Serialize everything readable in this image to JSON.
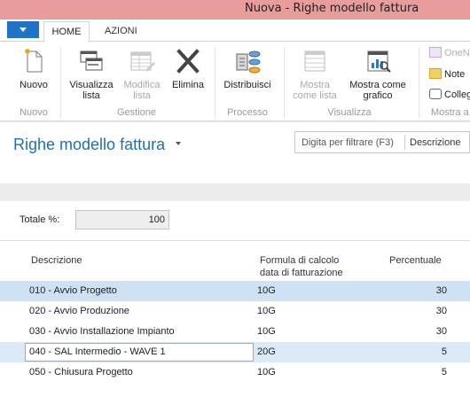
{
  "window": {
    "title": "Nuova - Righe modello fattura"
  },
  "tabs": {
    "home": "HOME",
    "azioni": "AZIONI"
  },
  "ribbon": {
    "nuovo": "Nuovo",
    "visualizza_lista": [
      "Visualizza",
      "lista"
    ],
    "modifica_lista": [
      "Modifica",
      "lista"
    ],
    "elimina": "Elimina",
    "distribuisci": "Distribuisci",
    "mostra_come_lista": [
      "Mostra",
      "come lista"
    ],
    "mostra_come_grafico": [
      "Mostra come",
      "grafico"
    ],
    "onenote": "OneN",
    "note": "Note",
    "collegamenti": "Colleg",
    "groups": {
      "nuovo": "Nuovo",
      "gestione": "Gestione",
      "processo": "Processo",
      "visualizza": "Visualizza",
      "mostra": "Mostra a"
    }
  },
  "page": {
    "title": "Righe modello fattura",
    "filter_placeholder": "Digita per filtrare (F3)",
    "filter_field": "Descrizione",
    "totale_label": "Totale %:",
    "totale_value": "100"
  },
  "grid": {
    "headers": {
      "descrizione": "Descrizione",
      "formula_1": "Formula di calcolo",
      "formula_2": "data di fatturazione",
      "percentuale": "Percentuale"
    },
    "rows": [
      {
        "descrizione": "010 - Avvio Progetto",
        "formula": "10G",
        "percentuale": "30"
      },
      {
        "descrizione": "020 - Avvio Produzione",
        "formula": "10G",
        "percentuale": "30"
      },
      {
        "descrizione": "030 - Avvio Installazione Impianto",
        "formula": "10G",
        "percentuale": "30"
      },
      {
        "descrizione": "040 - SAL Intermedio - WAVE 1",
        "formula": "20G",
        "percentuale": "5"
      },
      {
        "descrizione": "050 - Chiusura Progetto",
        "formula": "10G",
        "percentuale": "5"
      }
    ]
  },
  "colors": {
    "titlebar": "#e89c9c",
    "app_button": "#1e73c9",
    "page_title": "#1c6eb8",
    "selected_row": "#cde2f5"
  }
}
